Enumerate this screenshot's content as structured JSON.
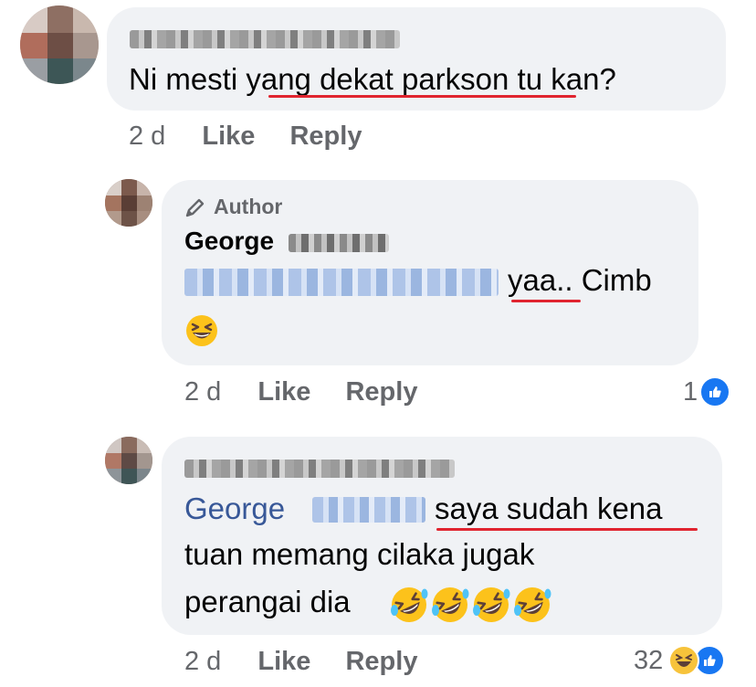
{
  "comments": [
    {
      "text_after_name": "",
      "message": "Ni mesti yang dekat parkson tu kan?",
      "message_plain": "Ni mesti ",
      "message_underlined": "yang dekat parkson",
      "message_tail": " tu kan?",
      "time": "2 d",
      "like_label": "Like",
      "reply_label": "Reply"
    },
    {
      "badge": "Author",
      "author_first": "George",
      "reply_text_underlined": "yaa..",
      "reply_text_tail": " Cimb",
      "time": "2 d",
      "like_label": "Like",
      "reply_label": "Reply",
      "reaction_count": "1"
    },
    {
      "mention_first": "George",
      "line1_underlined": "saya sudah kena",
      "line2": "tuan memang cilaka jugak",
      "line3": "perangai dia",
      "time": "2 d",
      "like_label": "Like",
      "reply_label": "Reply",
      "reaction_count": "32"
    }
  ],
  "colors": {
    "bubble": "#f0f2f5",
    "underline": "#e0242f",
    "mention": "#385898",
    "meta": "#65676b",
    "like": "#1877f2"
  },
  "icons": [
    "pencil-icon",
    "like-reaction-icon",
    "haha-reaction-icon",
    "grinning-squint-emoji",
    "rolling-laughing-emoji"
  ]
}
